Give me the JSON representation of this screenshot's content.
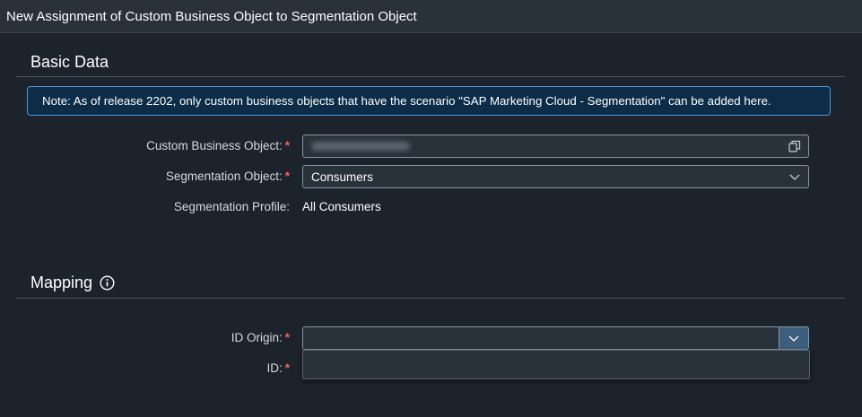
{
  "window": {
    "title": "New Assignment of Custom Business Object to Segmentation Object"
  },
  "basic_data": {
    "title": "Basic Data",
    "note": "Note: As of release 2202, only custom business objects that have the scenario \"SAP Marketing Cloud - Segmentation\" can be added here.",
    "custom_business_object": {
      "label": "Custom Business Object:",
      "value_hidden": true,
      "icon": "value-help-icon"
    },
    "segmentation_object": {
      "label": "Segmentation Object:",
      "value": "Consumers",
      "icon": "chevron-down-icon"
    },
    "segmentation_profile": {
      "label": "Segmentation Profile:",
      "value": "All Consumers"
    }
  },
  "mapping": {
    "title": "Mapping",
    "icon": "info-icon",
    "id_origin": {
      "label": "ID Origin:",
      "value": "",
      "icon": "chevron-down-icon"
    },
    "id": {
      "label": "ID:"
    }
  },
  "required_marker": "*",
  "colors": {
    "background": "#1d232c",
    "accent": "#3b5f7d",
    "note_border": "#4a97d8",
    "required": "#ff5c5c"
  }
}
